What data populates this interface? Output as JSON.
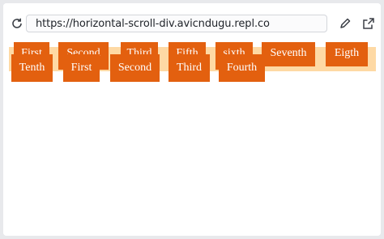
{
  "browser": {
    "url": "https://horizontal-scroll-div.avicndugu.repl.co",
    "icons": [
      "reload-icon",
      "edit-icon",
      "open-in-new-tab-icon"
    ]
  },
  "page": {
    "row1_items": [
      "First",
      "Second",
      "Third",
      "Fifth",
      "sixth",
      "Seventh",
      "Eigth"
    ],
    "row2_items": [
      "Tenth",
      "First",
      "Second",
      "Third",
      "Fourth"
    ],
    "colors": {
      "box": "#e3600f",
      "strip": "#fed9a4",
      "text": "#ffffff"
    }
  }
}
